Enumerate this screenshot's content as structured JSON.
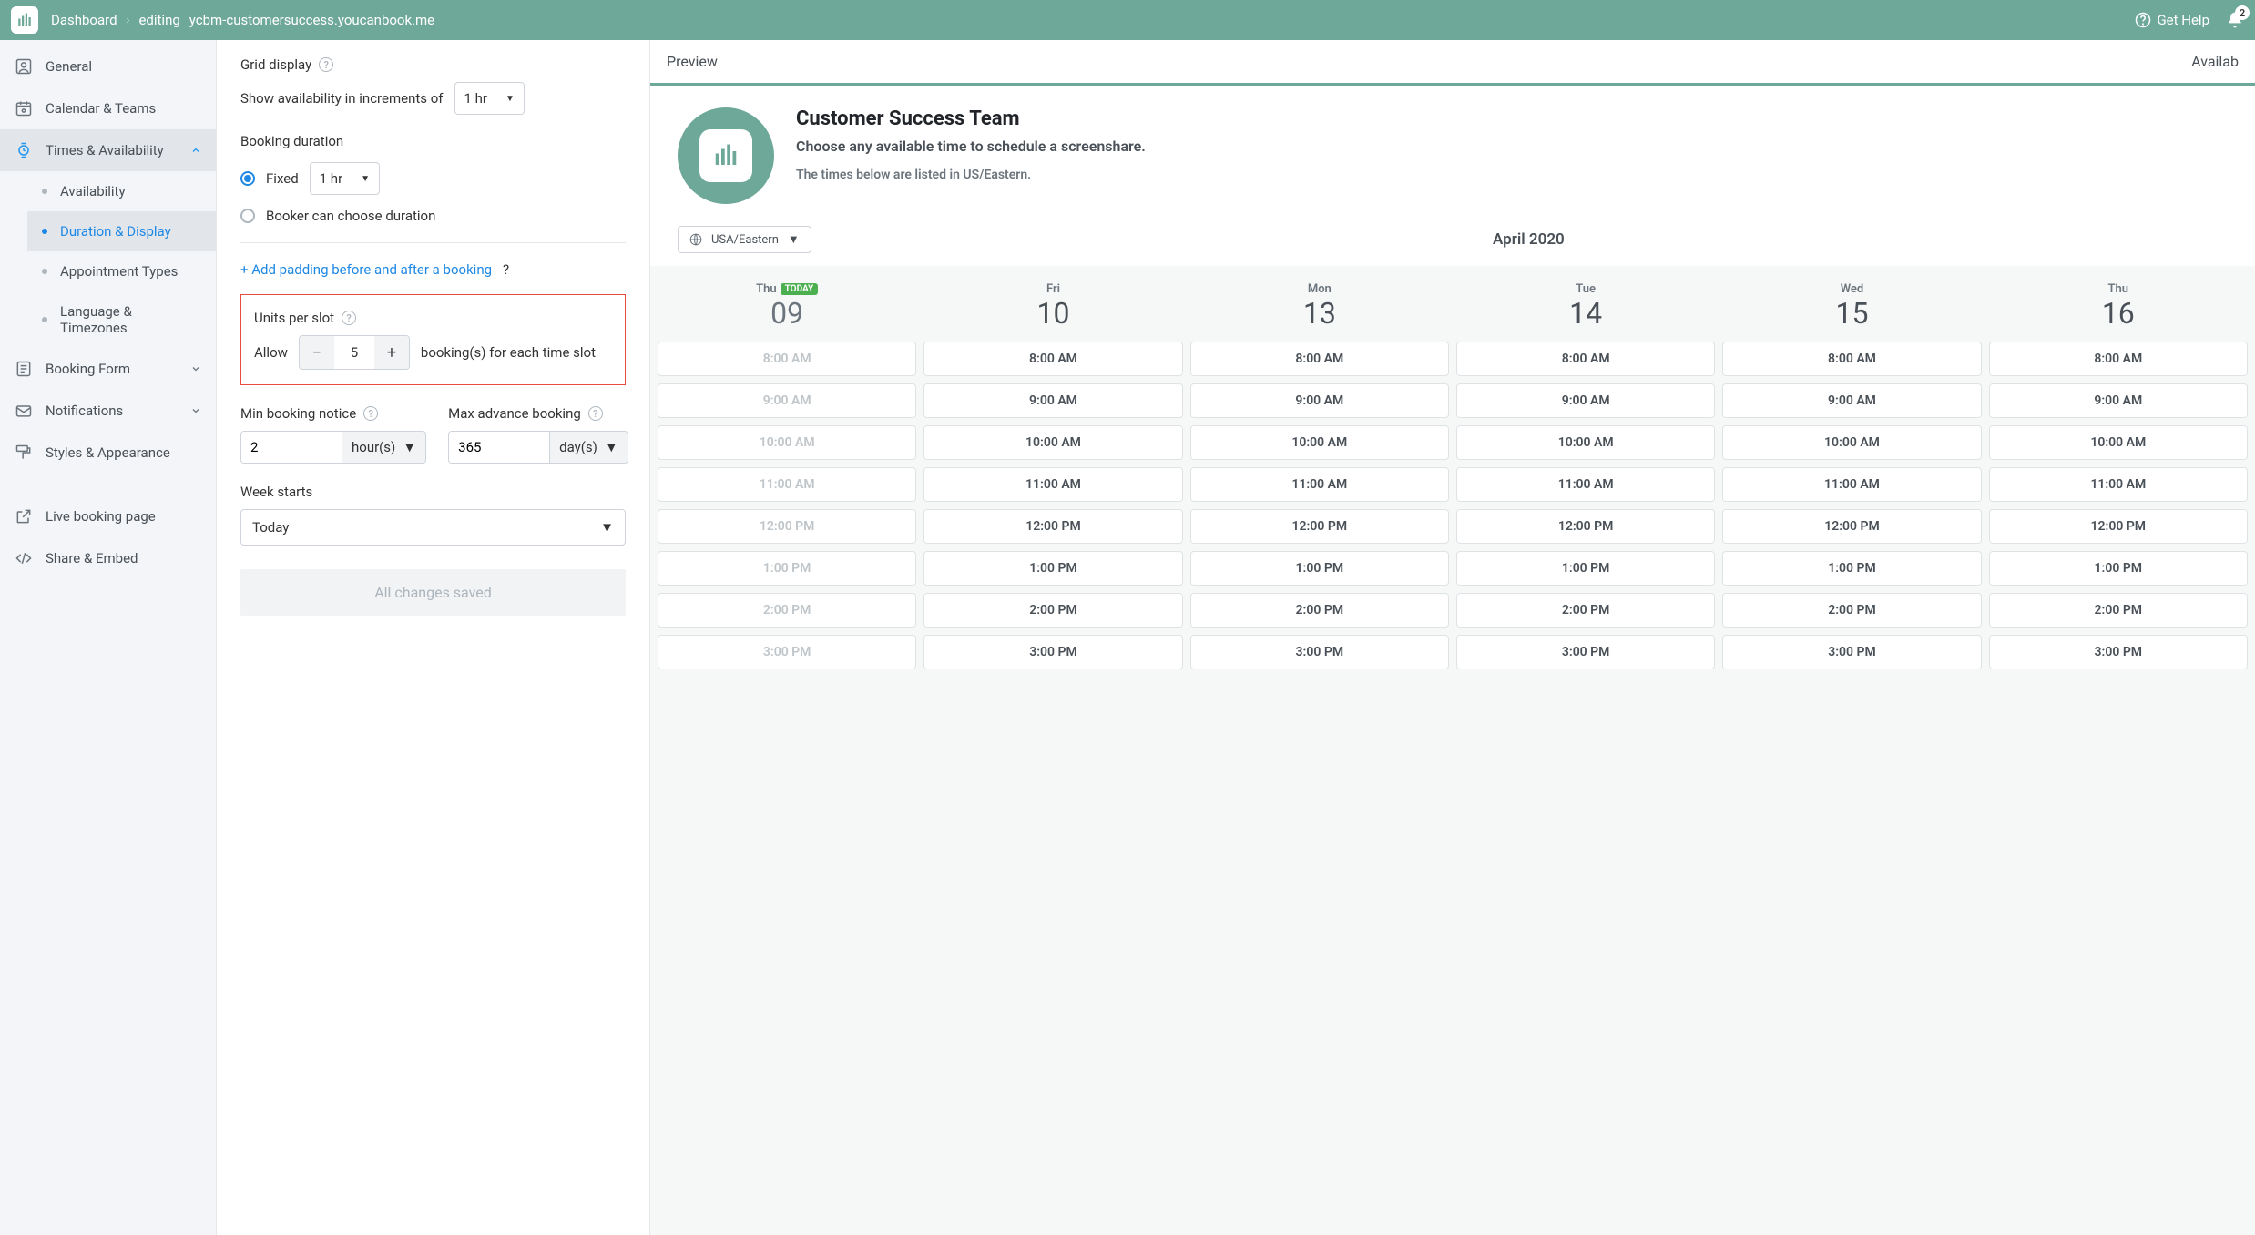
{
  "header": {
    "dashboard": "Dashboard",
    "editing": "editing",
    "url": "ycbm-customersuccess.youcanbook.me",
    "gethelp": "Get Help",
    "notif_count": "2"
  },
  "sidebar": {
    "general": "General",
    "calendar": "Calendar & Teams",
    "times": "Times & Availability",
    "availability": "Availability",
    "duration": "Duration & Display",
    "appointment": "Appointment Types",
    "language": "Language & Timezones",
    "bookingform": "Booking Form",
    "notifications": "Notifications",
    "styles": "Styles & Appearance",
    "livebooking": "Live booking page",
    "share": "Share & Embed"
  },
  "settings": {
    "grid_display": "Grid display",
    "increments_label": "Show availability in increments of",
    "increments_value": "1 hr",
    "booking_duration": "Booking duration",
    "fixed": "Fixed",
    "fixed_value": "1 hr",
    "booker_choose": "Booker can choose duration",
    "padding_link": "+ Add padding before and after a booking",
    "units_per_slot": "Units per slot",
    "allow": "Allow",
    "units_value": "5",
    "booking_suffix": "booking(s) for each time slot",
    "min_notice": "Min booking notice",
    "min_notice_val": "2",
    "min_notice_unit": "hour(s)",
    "max_advance": "Max advance booking",
    "max_advance_val": "365",
    "max_advance_unit": "day(s)",
    "week_starts": "Week starts",
    "week_starts_val": "Today",
    "saved": "All changes saved"
  },
  "preview": {
    "tab_preview": "Preview",
    "tab_availab": "Availab",
    "title": "Customer Success Team",
    "subtitle": "Choose any available time to schedule a screenshare.",
    "tz_note": "The times below are listed in US/Eastern.",
    "tz_select": "USA/Eastern",
    "month": "April 2020",
    "today_badge": "TODAY",
    "days": [
      {
        "dow": "Thu",
        "num": "09",
        "today": true,
        "disabled": true
      },
      {
        "dow": "Fri",
        "num": "10",
        "today": false,
        "disabled": false
      },
      {
        "dow": "Mon",
        "num": "13",
        "today": false,
        "disabled": false
      },
      {
        "dow": "Tue",
        "num": "14",
        "today": false,
        "disabled": false
      },
      {
        "dow": "Wed",
        "num": "15",
        "today": false,
        "disabled": false
      },
      {
        "dow": "Thu",
        "num": "16",
        "today": false,
        "disabled": false
      }
    ],
    "slots": [
      "8:00 AM",
      "9:00 AM",
      "10:00 AM",
      "11:00 AM",
      "12:00 PM",
      "1:00 PM",
      "2:00 PM",
      "3:00 PM"
    ]
  }
}
